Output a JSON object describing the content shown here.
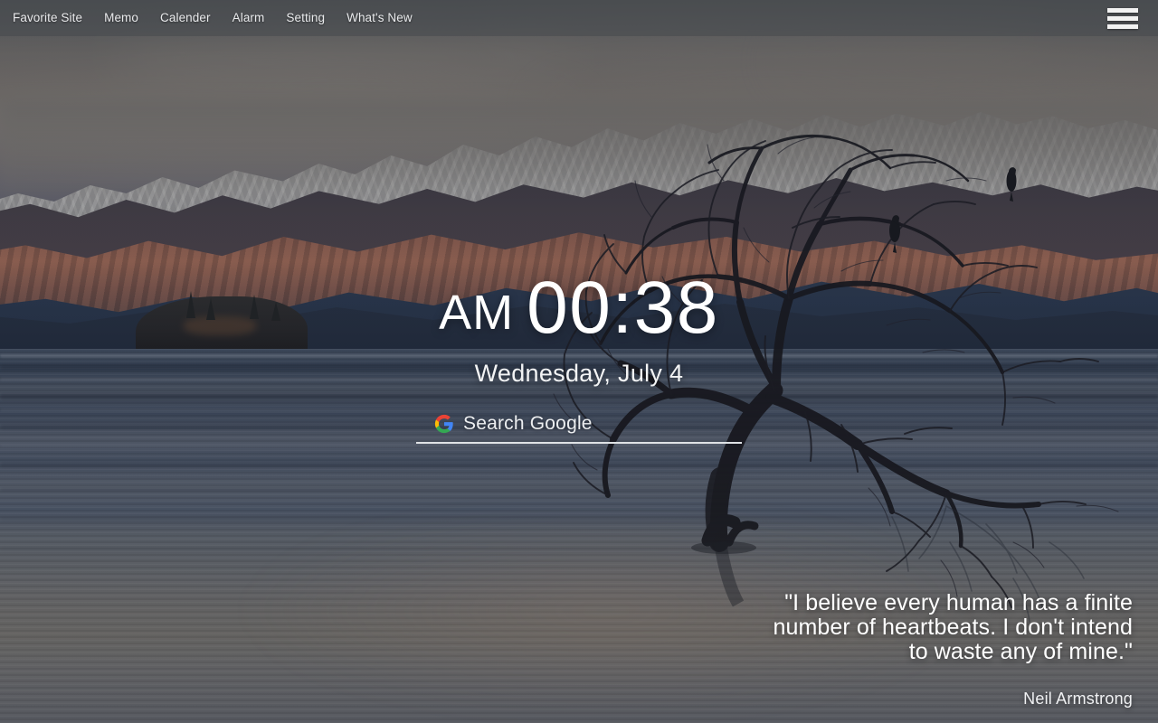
{
  "nav": {
    "items": [
      {
        "label": "Favorite Site",
        "name": "nav-favorite-site"
      },
      {
        "label": "Memo",
        "name": "nav-memo"
      },
      {
        "label": "Calender",
        "name": "nav-calender"
      },
      {
        "label": "Alarm",
        "name": "nav-alarm"
      },
      {
        "label": "Setting",
        "name": "nav-setting"
      },
      {
        "label": "What's New",
        "name": "nav-whats-new"
      }
    ],
    "menu_icon": "hamburger-menu-icon"
  },
  "clock": {
    "meridiem": "AM",
    "time": "00:38",
    "date": "Wednesday, July 4"
  },
  "search": {
    "placeholder": "Search Google",
    "value": "",
    "engine_icon": "google-g-icon",
    "engine": "Google"
  },
  "quote": {
    "text": "\"I believe every human has a finite number of heartbeats. I don't intend to waste any of mine.\"",
    "author": "Neil Armstrong"
  },
  "wallpaper": {
    "scene": "That Wanaka Tree at dusk over Lake Wanaka with snow-capped mountains",
    "accent_text_color": "#ffffff",
    "topbar_color": "#575a60",
    "sky_color": "#7a746f",
    "water_color": "#5e6168",
    "warm_slope_color": "#9b6552"
  }
}
